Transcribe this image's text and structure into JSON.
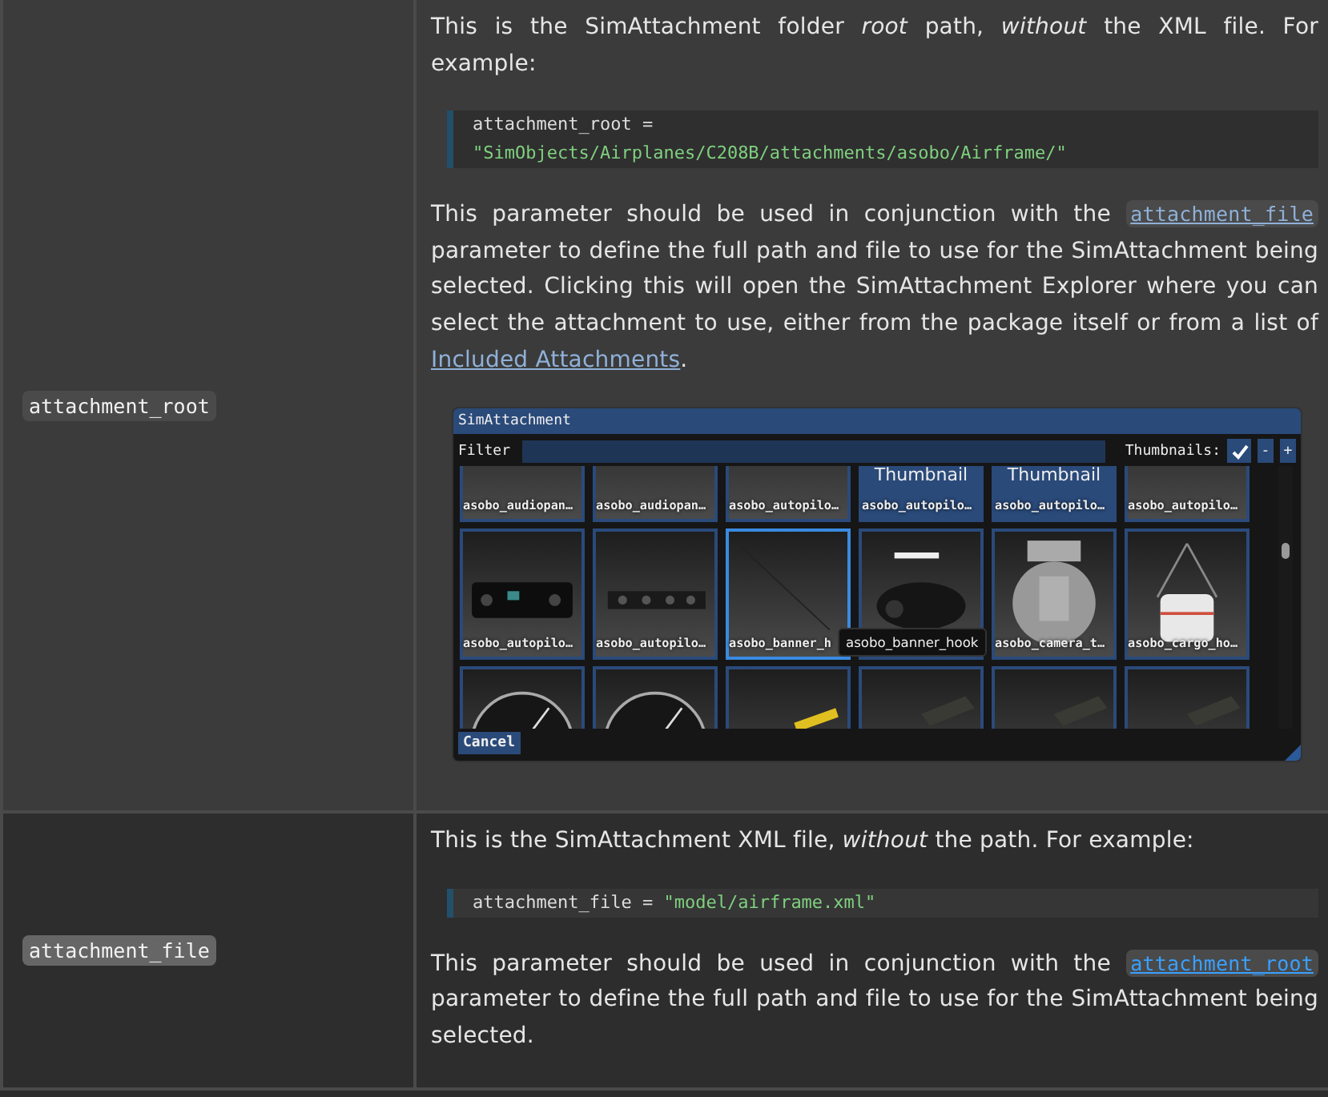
{
  "rows": [
    {
      "parameter": "attachment_root",
      "highlighted": false,
      "blocks": [
        {
          "kind": "para",
          "segments": [
            {
              "kind": "text",
              "text": "This is the SimAttachment folder *root* path, *without* the XML file. For example:"
            }
          ]
        },
        {
          "kind": "code",
          "lines": [
            [
              {
                "kind": "plain",
                "text": "attachment_root ="
              }
            ],
            [
              {
                "kind": "string",
                "text": "\"SimObjects/Airplanes/C208B/attachments/asobo/Airframe/\""
              }
            ]
          ]
        },
        {
          "kind": "para",
          "segments": [
            {
              "kind": "text",
              "text": "This parameter should be used in conjunction with the "
            },
            {
              "kind": "code_link",
              "text": "attachment_file"
            },
            {
              "kind": "text",
              "text": " parameter to define the full path and file to use for the SimAttachment being selected. Clicking this will open the SimAttachment Explorer where you can select the attachment to use, either from the package itself or from a list of "
            },
            {
              "kind": "link",
              "text": "Included Attachments"
            },
            {
              "kind": "text",
              "text": "."
            }
          ]
        },
        {
          "kind": "dialog",
          "title": "SimAttachment",
          "filter_label": "Filter",
          "thumbnails_label": "Thumbnails:",
          "thumbnails_checked": true,
          "size_buttons": [
            "-",
            "+"
          ],
          "tooltip": "asobo_banner_hook",
          "cancel": "Cancel",
          "tiles": [
            {
              "kind": "picture",
              "label": "asobo_audiopan…",
              "selected": false
            },
            {
              "kind": "picture",
              "label": "asobo_audiopan…",
              "selected": false
            },
            {
              "kind": "picture",
              "label": "asobo_autopilo…",
              "selected": false
            },
            {
              "kind": "text",
              "thumb_text": "Thumbnail",
              "label": "asobo_autopilo…",
              "selected": false
            },
            {
              "kind": "text",
              "thumb_text": "Thumbnail",
              "label": "asobo_autopilo…",
              "selected": false
            },
            {
              "kind": "picture",
              "label": "asobo_autopilo…",
              "selected": false
            },
            {
              "kind": "picture",
              "label": "asobo_autopilo…",
              "selected": false
            },
            {
              "kind": "picture",
              "label": "asobo_autopilo…",
              "selected": false
            },
            {
              "kind": "picture",
              "label": "asobo_banner_h",
              "selected": true
            },
            {
              "kind": "picture",
              "selected": false
            },
            {
              "kind": "picture",
              "label": "asobo_camera_t…",
              "selected": false
            },
            {
              "kind": "picture",
              "label": "asobo_cargo_ho…",
              "selected": false
            },
            {
              "kind": "picture",
              "selected": false
            },
            {
              "kind": "picture",
              "selected": false
            },
            {
              "kind": "picture",
              "selected": false
            },
            {
              "kind": "picture",
              "selected": false
            },
            {
              "kind": "picture",
              "selected": false
            },
            {
              "kind": "picture",
              "selected": false
            }
          ]
        }
      ]
    },
    {
      "parameter": "attachment_file",
      "highlighted": true,
      "blocks": [
        {
          "kind": "para",
          "segments": [
            {
              "kind": "text",
              "text": "This is the SimAttachment XML file, *without* the path. For example:"
            }
          ]
        },
        {
          "kind": "code",
          "lines": [
            [
              {
                "kind": "plain",
                "text": "attachment_file = "
              },
              {
                "kind": "string",
                "text": "\"model/airframe.xml\""
              }
            ]
          ]
        },
        {
          "kind": "para",
          "segments": [
            {
              "kind": "text",
              "text": "This parameter should be used in conjunction with the "
            },
            {
              "kind": "code_link",
              "text": "attachment_root"
            },
            {
              "kind": "text",
              "text": " parameter to define the full path and file to use for the SimAttachment being selected."
            }
          ]
        }
      ]
    }
  ]
}
